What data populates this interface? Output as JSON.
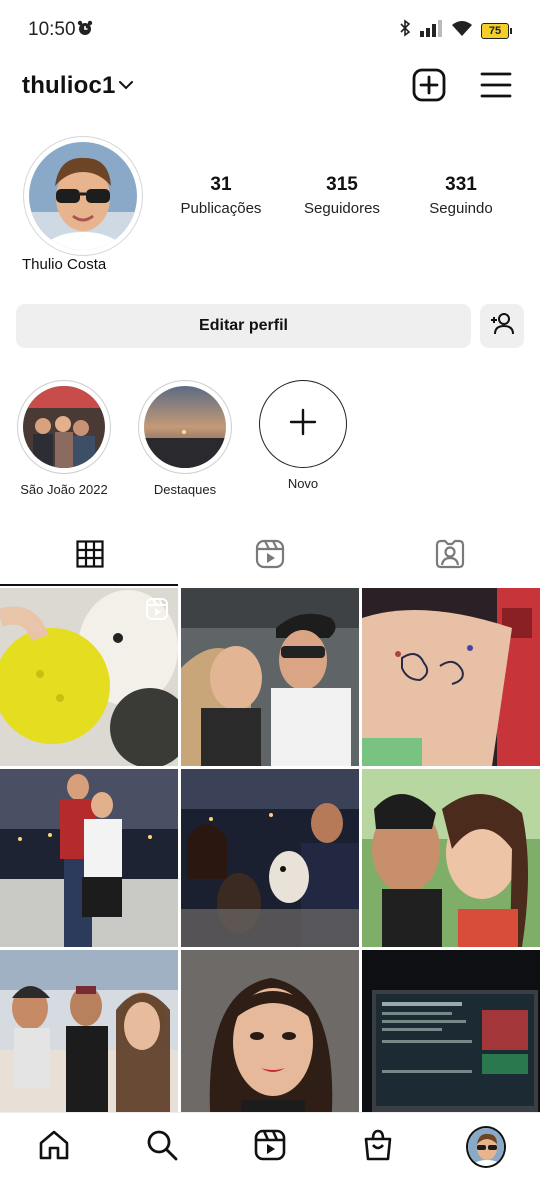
{
  "status_bar": {
    "time": "10:50",
    "battery": "75",
    "icons": [
      "alarm-icon",
      "bluetooth-icon",
      "signal-icon",
      "wifi-icon",
      "battery-icon"
    ]
  },
  "header": {
    "username": "thulioc1",
    "icons": [
      "chevron-down-icon",
      "new-post-icon",
      "menu-icon"
    ]
  },
  "profile": {
    "name": "Thulio Costa",
    "stats": [
      {
        "value": "31",
        "label": "Publicações"
      },
      {
        "value": "315",
        "label": "Seguidores"
      },
      {
        "value": "331",
        "label": "Seguindo"
      }
    ]
  },
  "actions": {
    "edit_label": "Editar perfil",
    "add_person_icon": "add-person-icon"
  },
  "highlights": [
    {
      "label": "São João 2022"
    },
    {
      "label": "Destaques"
    },
    {
      "label": "Novo"
    }
  ],
  "tabs": [
    {
      "icon": "grid-icon",
      "active": true
    },
    {
      "icon": "reels-icon",
      "active": false
    },
    {
      "icon": "tagged-icon",
      "active": false
    }
  ],
  "posts_count_shown": 9,
  "bottom_nav": [
    "home-icon",
    "search-icon",
    "reels-icon",
    "shop-icon",
    "profile-avatar"
  ],
  "colors": {
    "text": "#111111",
    "button_bg": "#efefef",
    "battery": "#f4cf2a"
  }
}
